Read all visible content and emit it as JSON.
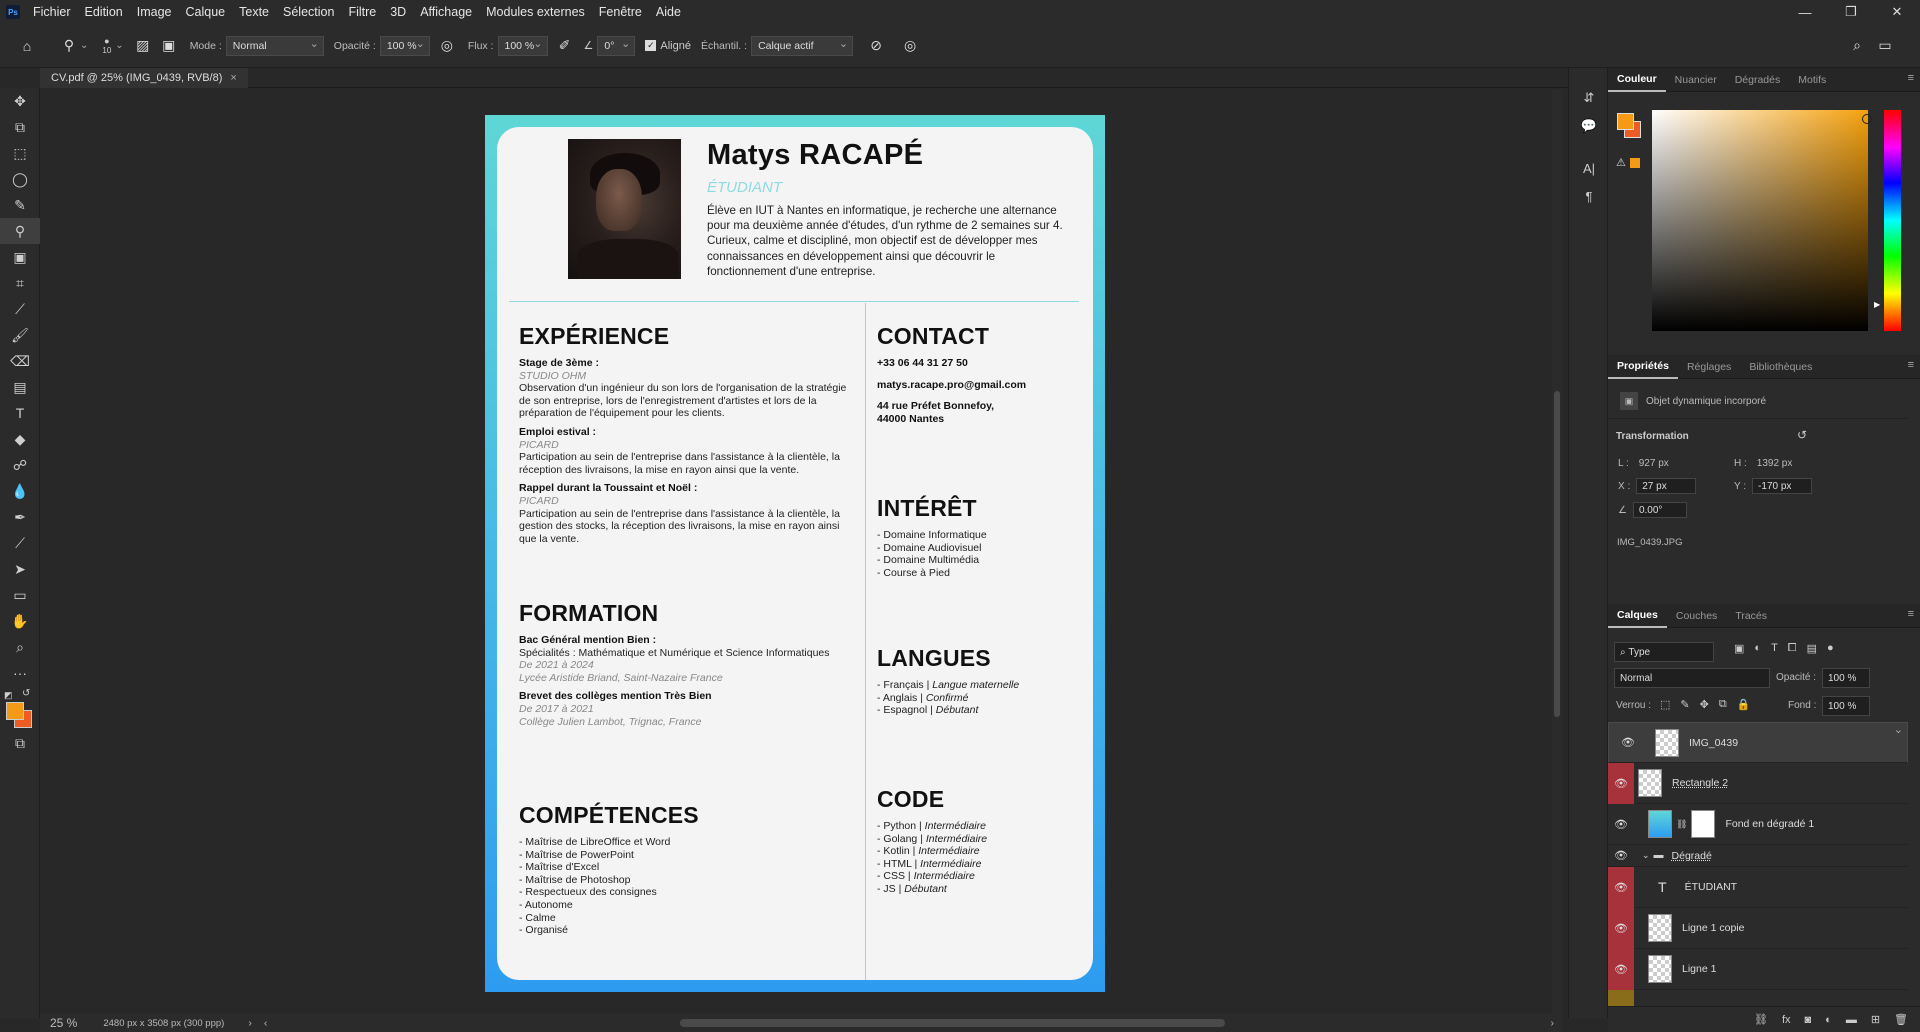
{
  "menu": {
    "items": [
      "Fichier",
      "Edition",
      "Image",
      "Calque",
      "Texte",
      "Sélection",
      "Filtre",
      "3D",
      "Affichage",
      "Modules externes",
      "Fenêtre",
      "Aide"
    ]
  },
  "options": {
    "brush_size": "10",
    "mode_label": "Mode :",
    "mode_value": "Normal",
    "opacity_label": "Opacité :",
    "opacity_value": "100 %",
    "flux_label": "Flux :",
    "flux_value": "100 %",
    "angle_value": "0°",
    "aligned_label": "Aligné",
    "sample_label": "Échantil. :",
    "sample_value": "Calque actif"
  },
  "document": {
    "tab_title": "CV.pdf @ 25% (IMG_0439, RVB/8)",
    "zoom": "25 %",
    "info": "2480 px x 3508 px (300 ppp)"
  },
  "cv": {
    "name": "Matys RACAPÉ",
    "role": "ÉTUDIANT",
    "intro": "Élève en IUT à Nantes en informatique, je recherche une alternance pour ma deuxième année d'études, d'un rythme de 2 semaines sur 4. Curieux, calme et discipliné, mon objectif est de développer mes connaissances en développement ainsi que découvrir le fonctionnement d'une entreprise.",
    "experience_title": "EXPÉRIENCE",
    "experience": [
      {
        "title": "Stage de 3ème :",
        "place": "STUDIO OHM",
        "desc": "Observation d'un ingénieur du son lors de l'organisation de la stratégie de son entreprise, lors de l'enregistrement d'artistes et lors de la préparation de l'équipement pour les clients."
      },
      {
        "title": "Emploi estival :",
        "place": "PICARD",
        "desc": "Participation au sein de l'entreprise dans l'assistance à la clientèle, la réception des livraisons, la mise en rayon ainsi que la vente."
      },
      {
        "title": "Rappel durant la Toussaint et Noël :",
        "place": "PICARD",
        "desc": "Participation au sein de l'entreprise dans l'assistance à la clientèle, la gestion des stocks, la réception des livraisons, la mise en rayon ainsi que la vente."
      }
    ],
    "formation_title": "FORMATION",
    "formation": [
      {
        "title": "Bac Général mention Bien :",
        "desc": "Spécialités : Mathématique et Numérique et Science Informatiques",
        "dates": "De 2021 à 2024",
        "place": "Lycée Aristide Briand, Saint-Nazaire France"
      },
      {
        "title": "Brevet des collèges mention Très Bien",
        "desc": "",
        "dates": "De 2017 à 2021",
        "place": "Collège Julien Lambot, Trignac, France"
      }
    ],
    "skills_title": "COMPÉTENCES",
    "skills": [
      "- Maîtrise de LibreOffice et Word",
      "- Maîtrise de PowerPoint",
      "- Maîtrise d'Excel",
      "- Maîtrise de Photoshop",
      "- Respectueux des consignes",
      "- Autonome",
      "- Calme",
      "- Organisé"
    ],
    "contact_title": "CONTACT",
    "phone": "+33 06 44 31 27 50",
    "email": "matys.racape.pro@gmail.com",
    "address_1": "44 rue Préfet Bonnefoy,",
    "address_2": "44000 Nantes",
    "interest_title": "INTÉRÊT",
    "interests": [
      "- Domaine Informatique",
      "- Domaine Audiovisuel",
      "- Domaine Multimédia",
      "- Course à Pied"
    ],
    "languages_title": "LANGUES",
    "languages": [
      {
        "name": "- Français | ",
        "level": "Langue maternelle"
      },
      {
        "name": "- Anglais | ",
        "level": "Confirmé"
      },
      {
        "name": "- Espagnol | ",
        "level": "Débutant"
      }
    ],
    "code_title": "CODE",
    "code": [
      {
        "name": "- Python | ",
        "level": "Intermédiaire"
      },
      {
        "name": "- Golang | ",
        "level": "Intermédiaire"
      },
      {
        "name": "- Kotlin | ",
        "level": "Intermédiaire"
      },
      {
        "name": "- HTML | ",
        "level": "Intermédiaire"
      },
      {
        "name": "- CSS | ",
        "level": "Intermédiaire"
      },
      {
        "name": "- JS | ",
        "level": "Débutant"
      }
    ]
  },
  "color_panel": {
    "tabs": [
      "Couleur",
      "Nuancier",
      "Dégradés",
      "Motifs"
    ],
    "fg": "#f59a16",
    "bg": "#ee5b23"
  },
  "properties": {
    "tabs": [
      "Propriétés",
      "Réglages",
      "Bibliothèques"
    ],
    "object_type": "Objet dynamique incorporé",
    "section": "Transformation",
    "w_label": "L :",
    "w_value": "927 px",
    "h_label": "H :",
    "h_value": "1392 px",
    "x_label": "X :",
    "x_value": "27 px",
    "y_label": "Y :",
    "y_value": "-170 px",
    "angle": "0.00°",
    "file": "IMG_0439.JPG"
  },
  "layers_panel": {
    "tabs": [
      "Calques",
      "Couches",
      "Tracés"
    ],
    "filter": "Type",
    "blend": "Normal",
    "opacity_label": "Opacité :",
    "opacity": "100 %",
    "lock_label": "Verrou :",
    "fill_label": "Fond :",
    "fill": "100 %",
    "layers": [
      "IMG_0439",
      "Rectangle 2",
      "Fond en dégradé 1",
      "Dégradé",
      "ÉTUDIANT",
      "Ligne 1 copie",
      "Ligne 1"
    ]
  }
}
